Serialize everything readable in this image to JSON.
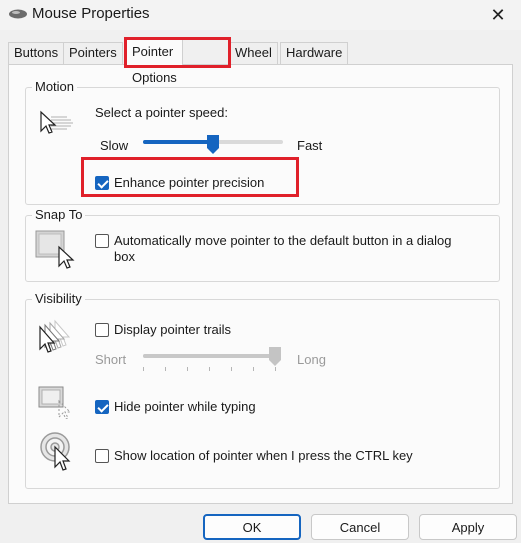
{
  "window": {
    "title": "Mouse Properties",
    "close": "✕"
  },
  "tabs": [
    "Buttons",
    "Pointers",
    "Pointer Options",
    "Wheel",
    "Hardware"
  ],
  "active_tab": "Pointer Options",
  "motion": {
    "title": "Motion",
    "speed_label": "Select a pointer speed:",
    "slow": "Slow",
    "fast": "Fast",
    "speed_level": 0.5,
    "precision_label": "Enhance pointer precision",
    "precision_checked": true
  },
  "snap_to": {
    "title": "Snap To",
    "label_line1": "Automatically move pointer to the default button in a dialog",
    "label_line2": "box",
    "checked": false
  },
  "visibility": {
    "title": "Visibility",
    "trails_label": "Display pointer trails",
    "trails_checked": false,
    "short": "Short",
    "long": "Long",
    "trails_level": 1.0,
    "hide_label": "Hide pointer while typing",
    "hide_checked": true,
    "ctrl_label": "Show location of pointer when I press the CTRL key",
    "ctrl_checked": false
  },
  "buttons": {
    "ok": "OK",
    "cancel": "Cancel",
    "apply": "Apply"
  },
  "colors": {
    "accent": "#1565c0",
    "highlight": "#e0202a"
  }
}
